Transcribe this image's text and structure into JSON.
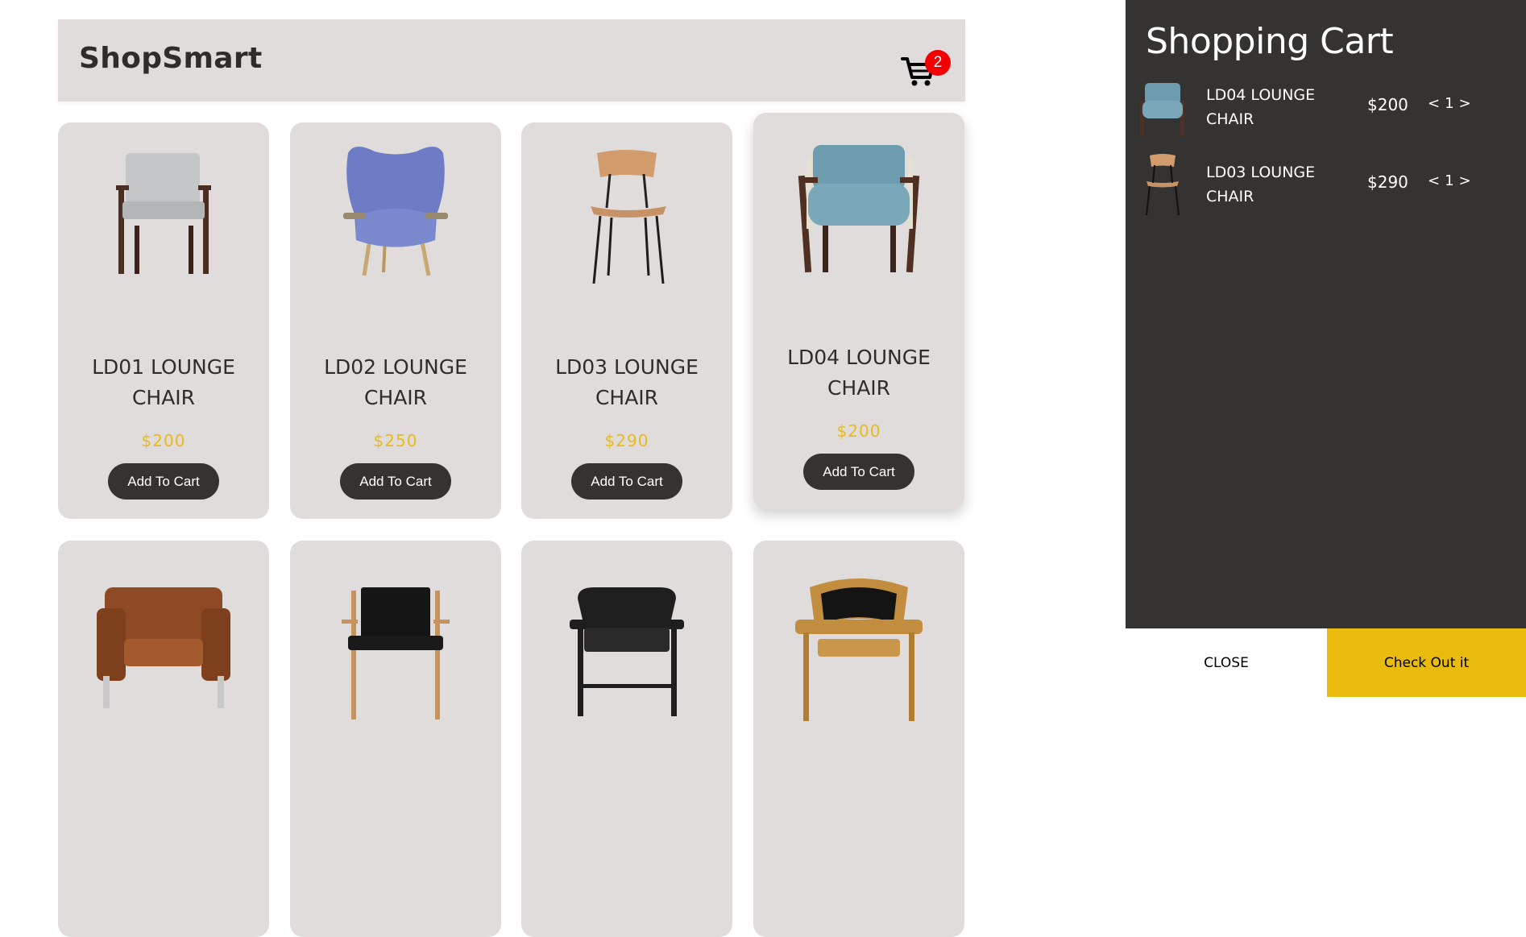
{
  "header": {
    "brand": "ShopSmart",
    "cart_count": "2",
    "cart_icon": "cart-icon"
  },
  "products": [
    {
      "name": "LD01 LOUNGE CHAIR",
      "price": "$200",
      "button": "Add To Cart"
    },
    {
      "name": "LD02 LOUNGE CHAIR",
      "price": "$250",
      "button": "Add To Cart"
    },
    {
      "name": "LD03 LOUNGE CHAIR",
      "price": "$290",
      "button": "Add To Cart"
    },
    {
      "name": "LD04 LOUNGE CHAIR",
      "price": "$200",
      "button": "Add To Cart"
    }
  ],
  "cart": {
    "title": "Shopping Cart",
    "items": [
      {
        "name": "LD04 LOUNGE CHAIR",
        "price": "$200",
        "dec": "<",
        "qty": "1",
        "inc": ">"
      },
      {
        "name": "LD03 LOUNGE CHAIR",
        "price": "$290",
        "dec": "<",
        "qty": "1",
        "inc": ">"
      }
    ],
    "close_label": "CLOSE",
    "checkout_label": "Check Out it"
  },
  "colors": {
    "accent": "#e8bb0e",
    "badge": "#f20000",
    "panel": "#353331",
    "card": "#e0dcdc"
  }
}
